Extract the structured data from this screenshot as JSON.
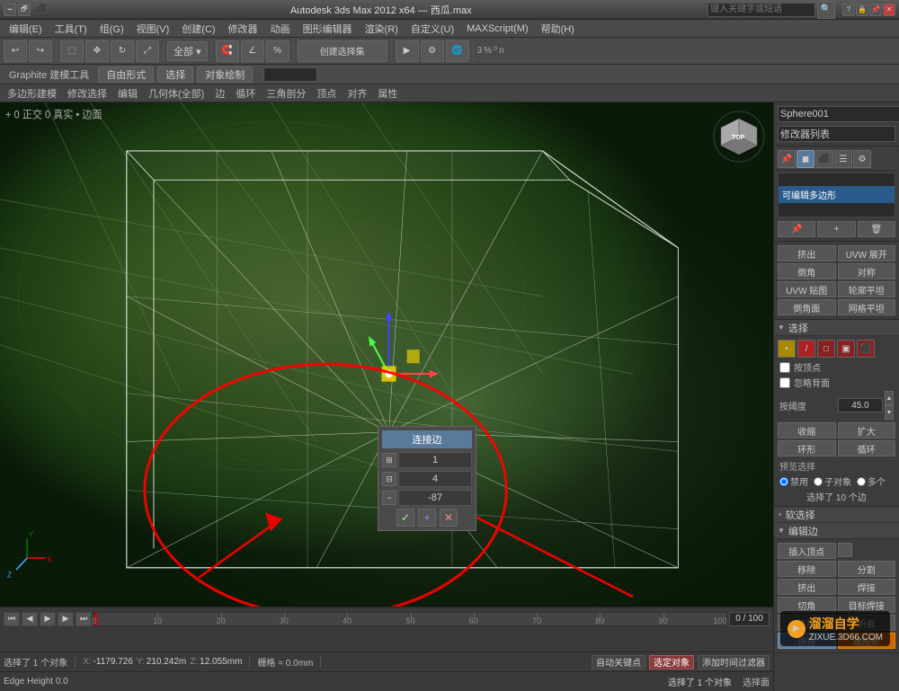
{
  "app": {
    "title": "Autodesk 3ds Max 2012 x64 — 西瓜.max",
    "search_placeholder": "键入关键字或短语"
  },
  "menubar": {
    "items": [
      "编辑(E)",
      "工具(T)",
      "组(G)",
      "视图(V)",
      "创建(C)",
      "修改器",
      "动画",
      "图形编辑器",
      "渲染(R)",
      "自定义(U)",
      "MAXScript(M)",
      "帮助(H)"
    ]
  },
  "toolbar": {
    "dropdown_label": "全部 ▾"
  },
  "graphite": {
    "label": "Graphite 建模工具",
    "tabs": [
      "自由形式",
      "选择",
      "对象绘制"
    ]
  },
  "subtoolbar": {
    "items": [
      "多边形建模",
      "修改选择",
      "编辑",
      "几何体(全部)",
      "边",
      "循环",
      "三角剖分",
      "顶点",
      "对齐",
      "属性"
    ]
  },
  "viewport": {
    "label": "+ 0 正交 0 真实 • 边面",
    "object_name": "Sphere001"
  },
  "connect_dialog": {
    "title": "连接边",
    "value1": "1",
    "value2": "4",
    "value3": "-87"
  },
  "right_panel": {
    "object_name": "Sphere001",
    "modifier_list_label": "修改器列表",
    "modifier_highlight": "可编辑多边形",
    "buttons": {
      "extrude": "挤出",
      "uvw_expand": "UVW 展开",
      "chamfer": "倒角",
      "symmetric": "对称",
      "uvw_map": "UVW 贴图",
      "outline_flat": "轮廓平坦",
      "bevel_face": "倒角面",
      "mesh_flat": "网格平坦"
    },
    "select_section": {
      "title": "选择",
      "by_vertex": "按顶点",
      "ignore_back": "忽略背面",
      "threshold_label": "按阈度",
      "threshold_value": "45.0",
      "shrink": "收缩",
      "expand": "扩大",
      "ring": "环形",
      "loop": "循环",
      "preview_select": "预览选择",
      "by_object": "禁用",
      "sub_object": "子对象",
      "multi": "多个",
      "selected_count": "选择了 10 个边"
    },
    "soft_select": "软选择",
    "edit_edge": "编辑边",
    "insert_vertex": "插入顶点",
    "remove": "移除",
    "split": "分割",
    "extrude2": "挤出",
    "weld": "焊接",
    "chamfer2": "切角",
    "target_weld": "目标焊接",
    "bridge": "连接",
    "crease": "折痕",
    "connect2": "连接",
    "make_shape": "建图形"
  },
  "statusbar": {
    "selected": "选择了 1 个对象",
    "x_label": "X:",
    "x_value": "-1179.726",
    "y_label": "Y:",
    "y_value": "210.242m",
    "z_label": "Z:",
    "z_value": "12.055mm",
    "grid_label": "栅格 = 0.0mm",
    "auto_key": "自动关键点",
    "set_key": "选定对象",
    "add_key": "添加时间过滤器",
    "edge_height": "Edge Height 0.0"
  },
  "timeline": {
    "frame_current": "0 / 100",
    "tick_labels": [
      "0",
      "10",
      "20",
      "30",
      "40",
      "50",
      "60",
      "70",
      "80",
      "90",
      "100"
    ]
  },
  "watermark": {
    "brand": "溜溜自学",
    "url": "ZIXUE.3D66.COM"
  }
}
